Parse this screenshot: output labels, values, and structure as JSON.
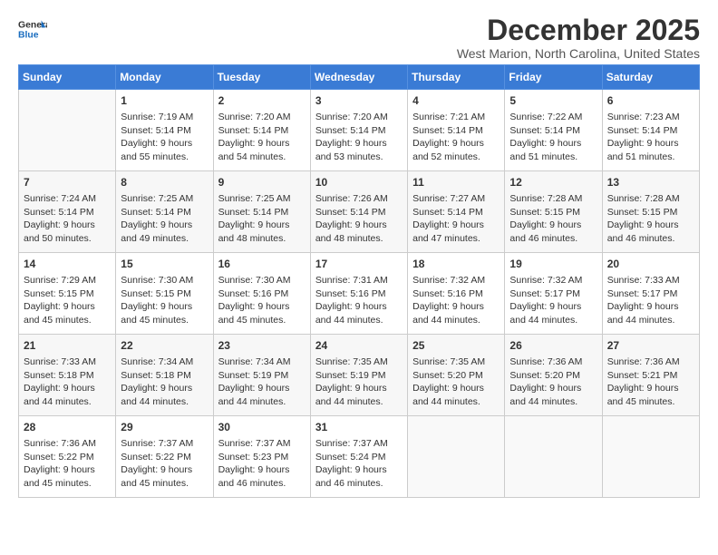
{
  "header": {
    "logo_line1": "General",
    "logo_line2": "Blue",
    "month": "December 2025",
    "location": "West Marion, North Carolina, United States"
  },
  "days_of_week": [
    "Sunday",
    "Monday",
    "Tuesday",
    "Wednesday",
    "Thursday",
    "Friday",
    "Saturday"
  ],
  "weeks": [
    [
      {
        "day": "",
        "data": ""
      },
      {
        "day": "1",
        "data": "Sunrise: 7:19 AM\nSunset: 5:14 PM\nDaylight: 9 hours\nand 55 minutes."
      },
      {
        "day": "2",
        "data": "Sunrise: 7:20 AM\nSunset: 5:14 PM\nDaylight: 9 hours\nand 54 minutes."
      },
      {
        "day": "3",
        "data": "Sunrise: 7:20 AM\nSunset: 5:14 PM\nDaylight: 9 hours\nand 53 minutes."
      },
      {
        "day": "4",
        "data": "Sunrise: 7:21 AM\nSunset: 5:14 PM\nDaylight: 9 hours\nand 52 minutes."
      },
      {
        "day": "5",
        "data": "Sunrise: 7:22 AM\nSunset: 5:14 PM\nDaylight: 9 hours\nand 51 minutes."
      },
      {
        "day": "6",
        "data": "Sunrise: 7:23 AM\nSunset: 5:14 PM\nDaylight: 9 hours\nand 51 minutes."
      }
    ],
    [
      {
        "day": "7",
        "data": "Sunrise: 7:24 AM\nSunset: 5:14 PM\nDaylight: 9 hours\nand 50 minutes."
      },
      {
        "day": "8",
        "data": "Sunrise: 7:25 AM\nSunset: 5:14 PM\nDaylight: 9 hours\nand 49 minutes."
      },
      {
        "day": "9",
        "data": "Sunrise: 7:25 AM\nSunset: 5:14 PM\nDaylight: 9 hours\nand 48 minutes."
      },
      {
        "day": "10",
        "data": "Sunrise: 7:26 AM\nSunset: 5:14 PM\nDaylight: 9 hours\nand 48 minutes."
      },
      {
        "day": "11",
        "data": "Sunrise: 7:27 AM\nSunset: 5:14 PM\nDaylight: 9 hours\nand 47 minutes."
      },
      {
        "day": "12",
        "data": "Sunrise: 7:28 AM\nSunset: 5:15 PM\nDaylight: 9 hours\nand 46 minutes."
      },
      {
        "day": "13",
        "data": "Sunrise: 7:28 AM\nSunset: 5:15 PM\nDaylight: 9 hours\nand 46 minutes."
      }
    ],
    [
      {
        "day": "14",
        "data": "Sunrise: 7:29 AM\nSunset: 5:15 PM\nDaylight: 9 hours\nand 45 minutes."
      },
      {
        "day": "15",
        "data": "Sunrise: 7:30 AM\nSunset: 5:15 PM\nDaylight: 9 hours\nand 45 minutes."
      },
      {
        "day": "16",
        "data": "Sunrise: 7:30 AM\nSunset: 5:16 PM\nDaylight: 9 hours\nand 45 minutes."
      },
      {
        "day": "17",
        "data": "Sunrise: 7:31 AM\nSunset: 5:16 PM\nDaylight: 9 hours\nand 44 minutes."
      },
      {
        "day": "18",
        "data": "Sunrise: 7:32 AM\nSunset: 5:16 PM\nDaylight: 9 hours\nand 44 minutes."
      },
      {
        "day": "19",
        "data": "Sunrise: 7:32 AM\nSunset: 5:17 PM\nDaylight: 9 hours\nand 44 minutes."
      },
      {
        "day": "20",
        "data": "Sunrise: 7:33 AM\nSunset: 5:17 PM\nDaylight: 9 hours\nand 44 minutes."
      }
    ],
    [
      {
        "day": "21",
        "data": "Sunrise: 7:33 AM\nSunset: 5:18 PM\nDaylight: 9 hours\nand 44 minutes."
      },
      {
        "day": "22",
        "data": "Sunrise: 7:34 AM\nSunset: 5:18 PM\nDaylight: 9 hours\nand 44 minutes."
      },
      {
        "day": "23",
        "data": "Sunrise: 7:34 AM\nSunset: 5:19 PM\nDaylight: 9 hours\nand 44 minutes."
      },
      {
        "day": "24",
        "data": "Sunrise: 7:35 AM\nSunset: 5:19 PM\nDaylight: 9 hours\nand 44 minutes."
      },
      {
        "day": "25",
        "data": "Sunrise: 7:35 AM\nSunset: 5:20 PM\nDaylight: 9 hours\nand 44 minutes."
      },
      {
        "day": "26",
        "data": "Sunrise: 7:36 AM\nSunset: 5:20 PM\nDaylight: 9 hours\nand 44 minutes."
      },
      {
        "day": "27",
        "data": "Sunrise: 7:36 AM\nSunset: 5:21 PM\nDaylight: 9 hours\nand 45 minutes."
      }
    ],
    [
      {
        "day": "28",
        "data": "Sunrise: 7:36 AM\nSunset: 5:22 PM\nDaylight: 9 hours\nand 45 minutes."
      },
      {
        "day": "29",
        "data": "Sunrise: 7:37 AM\nSunset: 5:22 PM\nDaylight: 9 hours\nand 45 minutes."
      },
      {
        "day": "30",
        "data": "Sunrise: 7:37 AM\nSunset: 5:23 PM\nDaylight: 9 hours\nand 46 minutes."
      },
      {
        "day": "31",
        "data": "Sunrise: 7:37 AM\nSunset: 5:24 PM\nDaylight: 9 hours\nand 46 minutes."
      },
      {
        "day": "",
        "data": ""
      },
      {
        "day": "",
        "data": ""
      },
      {
        "day": "",
        "data": ""
      }
    ]
  ]
}
